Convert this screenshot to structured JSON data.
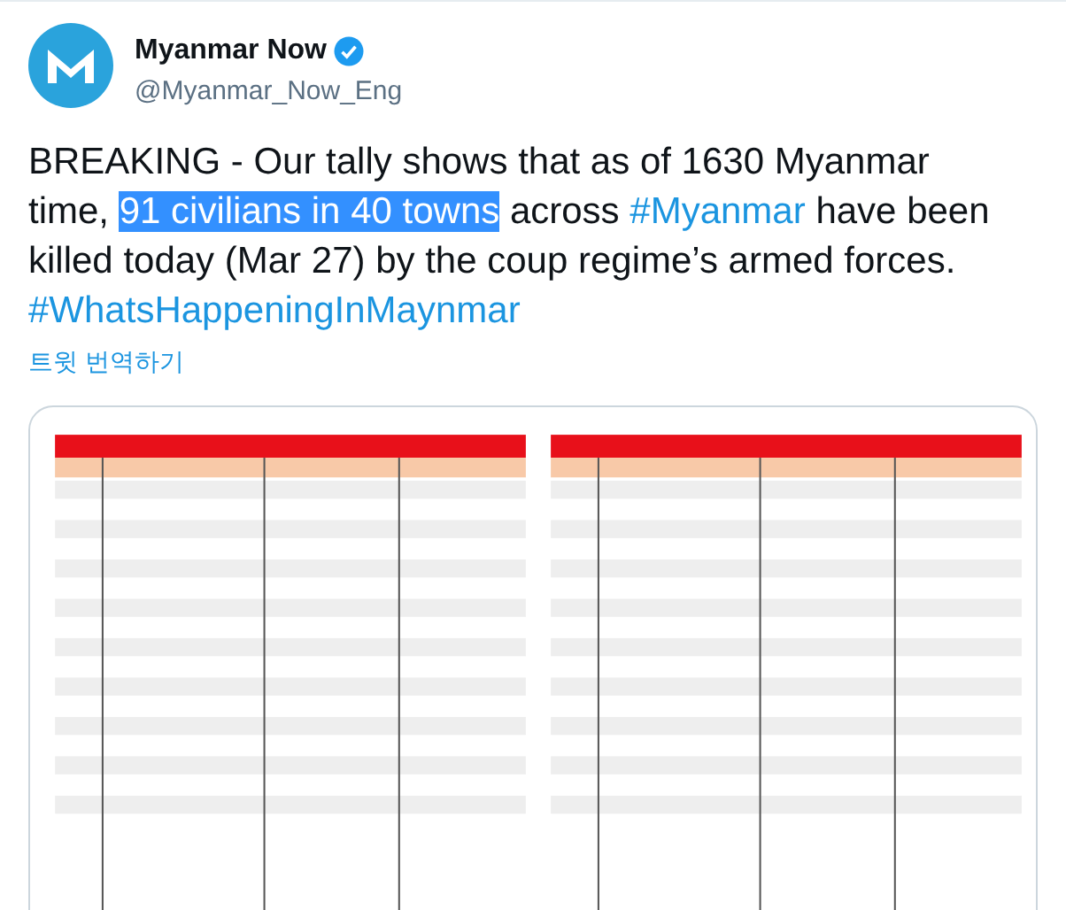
{
  "author": {
    "name": "Myanmar Now",
    "verified": true,
    "handle": "@Myanmar_Now_Eng"
  },
  "tweet": {
    "segments": [
      {
        "kind": "plain",
        "text": "BREAKING - Our tally shows that as of 1630 Myanmar time, ",
        "selected": false
      },
      {
        "kind": "plain",
        "text": "91 civilians in 40 towns",
        "selected": true
      },
      {
        "kind": "plain",
        "text": " across ",
        "selected": false
      },
      {
        "kind": "hashtag",
        "text": "#Myanmar",
        "selected": false
      },
      {
        "kind": "plain",
        "text": " have been killed today (Mar 27) by the coup regime’s armed forces. ",
        "selected": false
      },
      {
        "kind": "hashtag",
        "text": "#WhatsHappeningInMaynmar",
        "selected": false
      }
    ]
  },
  "translate_link": "트윗 번역하기"
}
